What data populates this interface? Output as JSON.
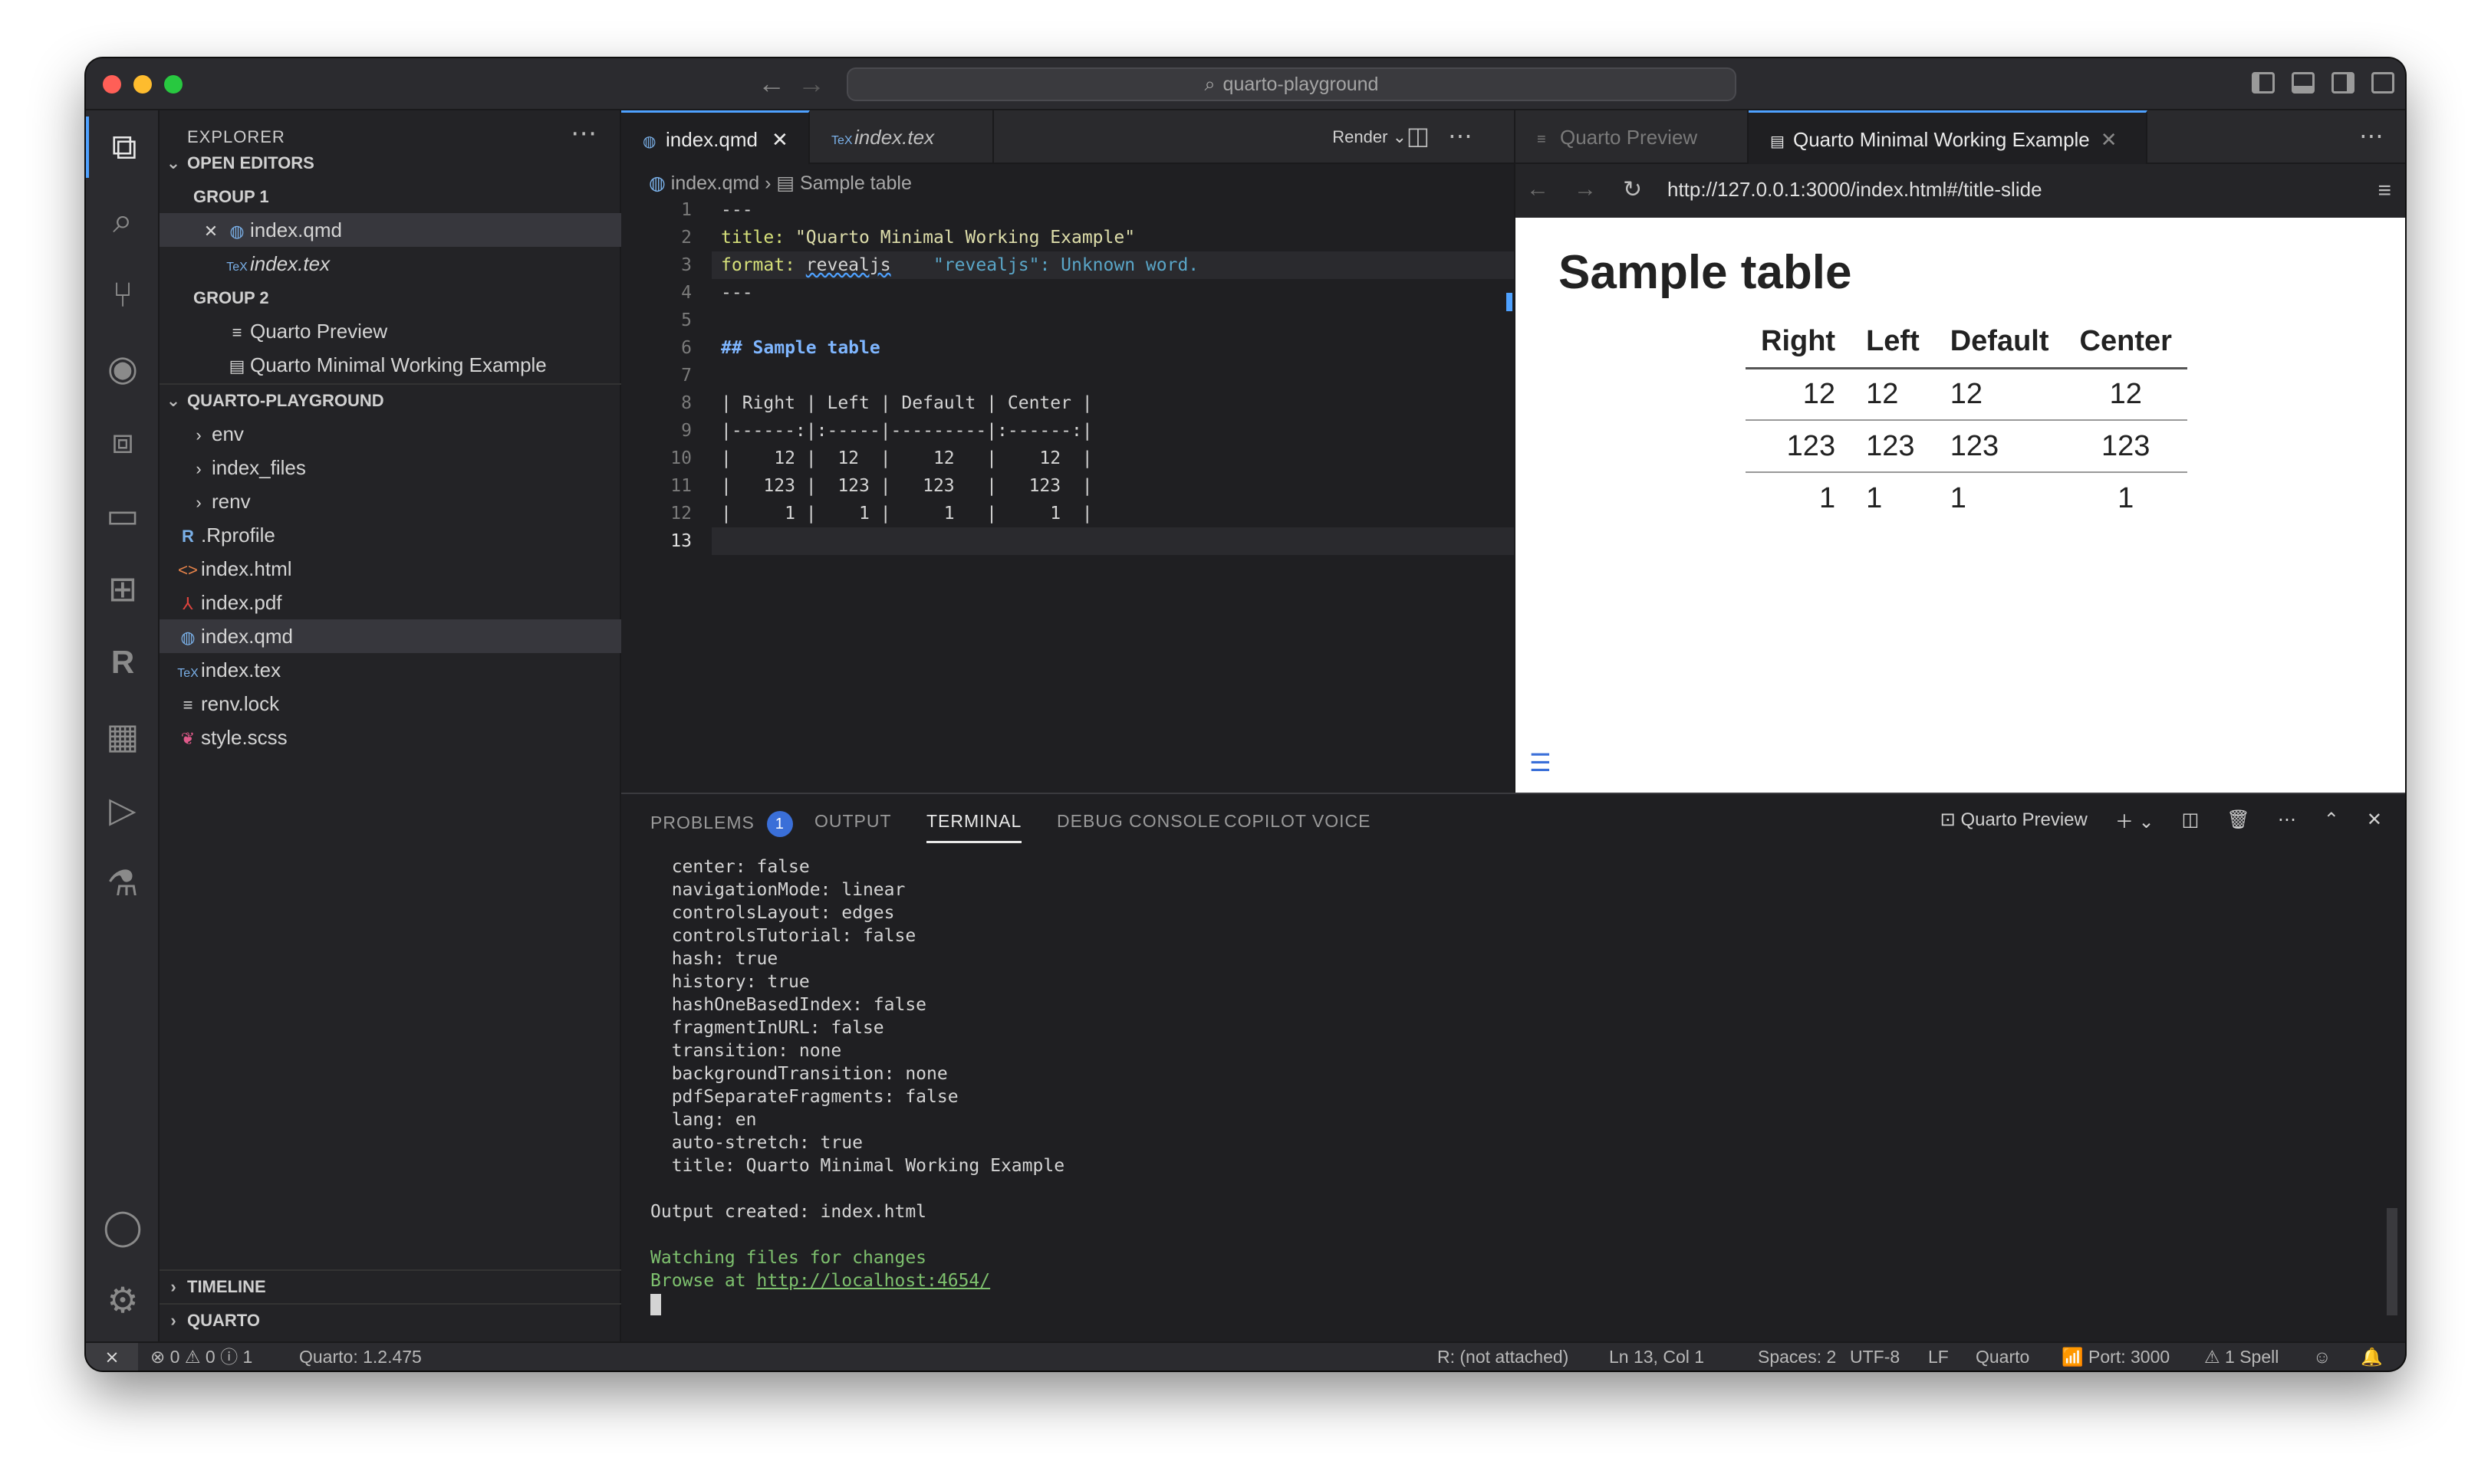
{
  "window": {
    "title": "quarto-playground"
  },
  "activity_bar": {
    "items": [
      {
        "name": "explorer-icon",
        "glyph": "⧉",
        "active": true
      },
      {
        "name": "search-icon",
        "glyph": "⌕"
      },
      {
        "name": "source-control-icon",
        "glyph": "⑂"
      },
      {
        "name": "github-icon",
        "glyph": "◉"
      },
      {
        "name": "remote-explorer-icon",
        "glyph": "⧈"
      },
      {
        "name": "remote-window-icon",
        "glyph": "▭"
      },
      {
        "name": "extensions-icon",
        "glyph": "⊞"
      },
      {
        "name": "r-language-icon",
        "glyph": "R"
      },
      {
        "name": "docker-icon",
        "glyph": "▦"
      },
      {
        "name": "run-debug-icon",
        "glyph": "▷"
      },
      {
        "name": "testing-icon",
        "glyph": "⚗"
      }
    ],
    "bottom": [
      {
        "name": "account-icon",
        "glyph": "◯"
      },
      {
        "name": "settings-gear-icon",
        "glyph": "⚙"
      }
    ]
  },
  "sidebar": {
    "header": "EXPLORER",
    "open_editors": {
      "label": "OPEN EDITORS",
      "group1": "GROUP 1",
      "group1_items": [
        "index.qmd",
        "index.tex"
      ],
      "group2": "GROUP 2",
      "group2_items": [
        "Quarto Preview",
        "Quarto Minimal Working Example"
      ]
    },
    "folder": {
      "label": "QUARTO-PLAYGROUND",
      "items": [
        {
          "label": "env",
          "icon": ">",
          "type": "folder"
        },
        {
          "label": "index_files",
          "icon": ">",
          "type": "folder"
        },
        {
          "label": "renv",
          "icon": ">",
          "type": "folder"
        },
        {
          "label": ".Rprofile",
          "icon": "R",
          "type": "file"
        },
        {
          "label": "index.html",
          "icon": "<>",
          "type": "file"
        },
        {
          "label": "index.pdf",
          "icon": "⅄",
          "type": "file"
        },
        {
          "label": "index.qmd",
          "icon": "◍",
          "type": "file",
          "selected": true
        },
        {
          "label": "index.tex",
          "icon": "TeX",
          "type": "file"
        },
        {
          "label": "renv.lock",
          "icon": "≡",
          "type": "file"
        },
        {
          "label": "style.scss",
          "icon": "❦",
          "type": "file"
        }
      ]
    },
    "timeline": "TIMELINE",
    "quarto": "QUARTO"
  },
  "editor": {
    "tabs": [
      "index.qmd",
      "index.tex"
    ],
    "render_label": "Render",
    "breadcrumb": [
      "index.qmd",
      "Sample table"
    ],
    "lines": [
      "---",
      "title: \"Quarto Minimal Working Example\"",
      "format: revealjs",
      "---",
      "",
      "## Sample table",
      "",
      "| Right | Left | Default | Center |",
      "|------:|:-----|---------|:------:|",
      "|    12 |  12  |    12   |    12  |",
      "|   123 |  123 |   123   |   123  |",
      "|     1 |    1 |     1   |     1  |",
      ""
    ],
    "line_numbers": [
      "1",
      "2",
      "3",
      "4",
      "5",
      "6",
      "7",
      "8",
      "9",
      "10",
      "11",
      "12",
      "13"
    ],
    "title_key": "title:",
    "title_value": "\"Quarto Minimal Working Example\"",
    "format_key": "format:",
    "format_value": "revealjs",
    "format_hint": "\"revealjs\": Unknown word."
  },
  "preview": {
    "tabs": [
      "Quarto Preview",
      "Quarto Minimal Working Example"
    ],
    "url": "http://127.0.0.1:3000/index.html#/title-slide",
    "slide": {
      "heading": "Sample table",
      "columns": [
        "Right",
        "Left",
        "Default",
        "Center"
      ],
      "rows": [
        [
          "12",
          "12",
          "12",
          "12"
        ],
        [
          "123",
          "123",
          "123",
          "123"
        ],
        [
          "1",
          "1",
          "1",
          "1"
        ]
      ]
    }
  },
  "panel": {
    "tabs": [
      "PROBLEMS",
      "OUTPUT",
      "TERMINAL",
      "DEBUG CONSOLE",
      "COPILOT VOICE"
    ],
    "problems_count": "1",
    "terminal_name": "Quarto Preview",
    "terminal_lines": [
      "  center: false",
      "  navigationMode: linear",
      "  controlsLayout: edges",
      "  controlsTutorial: false",
      "  hash: true",
      "  history: true",
      "  hashOneBasedIndex: false",
      "  fragmentInURL: false",
      "  transition: none",
      "  backgroundTransition: none",
      "  pdfSeparateFragments: false",
      "  lang: en",
      "  auto-stretch: true",
      "  title: Quarto Minimal Working Example",
      "",
      "Output created: index.html",
      ""
    ],
    "watching": "Watching files for changes",
    "browse_prefix": "Browse at ",
    "browse_url": "http://localhost:4654/"
  },
  "statusbar": {
    "errors": "0",
    "warnings": "0",
    "info": "1",
    "quarto_version": "Quarto: 1.2.475",
    "r_status": "R: (not attached)",
    "position": "Ln 13, Col 1",
    "spaces": "Spaces: 2",
    "encoding": "UTF-8",
    "eol": "LF",
    "language": "Quarto",
    "port": "Port: 3000",
    "spell": "1 Spell"
  }
}
